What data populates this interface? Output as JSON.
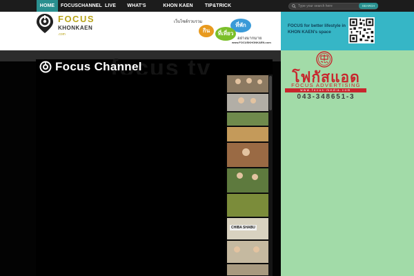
{
  "nav": {
    "items": [
      {
        "label": "HOME",
        "active": true
      },
      {
        "label": "FOCUSCHANNEL",
        "active": false
      },
      {
        "label": "LIVE",
        "active": false
      },
      {
        "label": "WHAT'S ON!",
        "active": false
      },
      {
        "label": "KHON KAEN GUIDE",
        "active": false
      },
      {
        "label": "TIP&TRICK",
        "active": false
      }
    ],
    "search": {
      "placeholder": "Type your search here",
      "button_label": "SEARCH"
    }
  },
  "header": {
    "logo": {
      "focus": "FOCUS",
      "city": "KHONKAEN",
      "tld": ".com"
    },
    "banner": {
      "line1": "เว็บไซต์รวบรวม",
      "bubble_eat": "กิน",
      "bubble_stay": "ที่พัก",
      "bubble_travel": "ที่เที่ยว",
      "line2": "อย่างมากมาย",
      "url": "www.FOCUSKHONKAEN.com"
    },
    "tagline": "FOCUS for better lifestyle in KHON KAEN's space"
  },
  "channel": {
    "title": "Focus  Channel",
    "watermark": "focus tv"
  },
  "thumbnails": {
    "shabu_label": "CHIBA  SHABU"
  },
  "ad": {
    "thai_name": "โฟกัสแอด",
    "english_name": "FOCUS ADVERTISING",
    "url": "www.focus-media.com",
    "phone": "043-348651-3"
  },
  "colors": {
    "nav_bg": "#1c1c1c",
    "nav_active": "#2a8f8f",
    "header_accent": "#36b6c6",
    "sidebar_bg": "#a2dba8",
    "logo_gold": "#b9a51a",
    "ad_red": "#c8262d"
  }
}
